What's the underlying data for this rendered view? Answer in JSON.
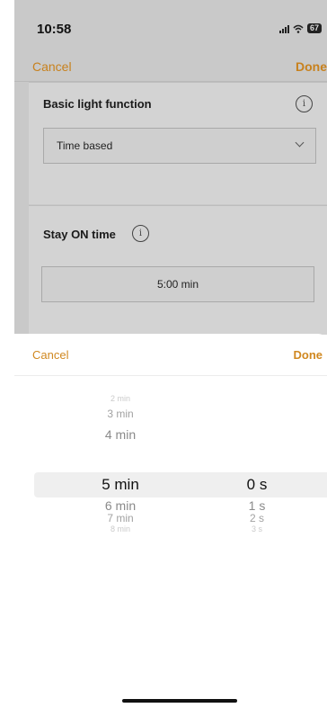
{
  "status_bar": {
    "time": "10:58",
    "battery": "67"
  },
  "nav": {
    "cancel": "Cancel",
    "done": "Done"
  },
  "settings": {
    "basic_light": {
      "title": "Basic light function",
      "value": "Time based",
      "info": "i"
    },
    "stay_on": {
      "title": "Stay ON time",
      "value": "5:00 min",
      "info": "i"
    }
  },
  "picker_sheet": {
    "cancel": "Cancel",
    "done": "Done",
    "minutes": [
      "2 min",
      "3 min",
      "4 min",
      "5 min",
      "6 min",
      "7 min",
      "8 min"
    ],
    "seconds": [
      "0 s",
      "1 s",
      "2 s",
      "3 s"
    ],
    "selected_minutes": "5 min",
    "selected_seconds": "0 s"
  },
  "colors": {
    "accent": "#d08820",
    "dim_overlay": "#c9c9c9"
  }
}
